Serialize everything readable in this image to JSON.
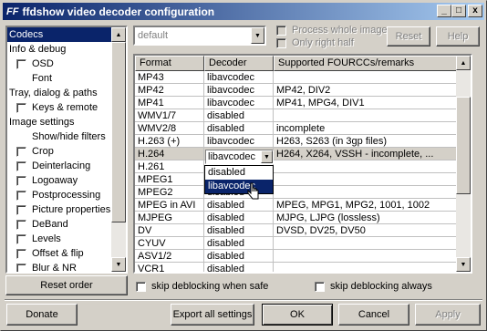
{
  "window": {
    "logo": "FF",
    "title": "ffdshow video decoder configuration",
    "min_label": "_",
    "max_label": "□",
    "close_label": "x"
  },
  "top": {
    "preset_value": "default",
    "process_whole_image": "Process whole image",
    "only_right_half": "Only right half",
    "reset_label": "Reset",
    "help_label": "Help"
  },
  "sidebar": {
    "items": [
      {
        "label": "Codecs",
        "check": false,
        "indent": 0,
        "selected": true
      },
      {
        "label": "Info & debug",
        "check": false,
        "indent": 0,
        "selected": false
      },
      {
        "label": "OSD",
        "check": true,
        "indent": 1,
        "selected": false
      },
      {
        "label": "Font",
        "check": false,
        "indent": 2,
        "selected": false
      },
      {
        "label": "Tray, dialog & paths",
        "check": false,
        "indent": 0,
        "selected": false
      },
      {
        "label": "Keys & remote",
        "check": true,
        "indent": 1,
        "selected": false
      },
      {
        "label": "Image settings",
        "check": false,
        "indent": 0,
        "selected": false
      },
      {
        "label": "Show/hide filters",
        "check": false,
        "indent": 2,
        "selected": false
      },
      {
        "label": "Crop",
        "check": true,
        "indent": 1,
        "selected": false
      },
      {
        "label": "Deinterlacing",
        "check": true,
        "indent": 1,
        "selected": false
      },
      {
        "label": "Logoaway",
        "check": true,
        "indent": 1,
        "selected": false
      },
      {
        "label": "Postprocessing",
        "check": true,
        "indent": 1,
        "selected": false
      },
      {
        "label": "Picture properties",
        "check": true,
        "indent": 1,
        "selected": false
      },
      {
        "label": "DeBand",
        "check": true,
        "indent": 1,
        "selected": false
      },
      {
        "label": "Levels",
        "check": true,
        "indent": 1,
        "selected": false
      },
      {
        "label": "Offset & flip",
        "check": true,
        "indent": 1,
        "selected": false
      },
      {
        "label": "Blur & NR",
        "check": true,
        "indent": 1,
        "selected": false
      }
    ],
    "reset_order_label": "Reset order"
  },
  "table": {
    "headers": [
      "Format",
      "Decoder",
      "Supported FOURCCs/remarks"
    ],
    "rows": [
      [
        "MP43",
        "libavcodec",
        ""
      ],
      [
        "MP42",
        "libavcodec",
        "MP42, DIV2"
      ],
      [
        "MP41",
        "libavcodec",
        "MP41, MPG4, DIV1"
      ],
      [
        "WMV1/7",
        "disabled",
        ""
      ],
      [
        "WMV2/8",
        "disabled",
        "incomplete"
      ],
      [
        "H.263 (+)",
        "libavcodec",
        "H263, S263 (in 3gp files)"
      ],
      [
        "H.264",
        "libavcodec",
        "H264, X264, VSSH - incomplete, ..."
      ],
      [
        "H.261",
        "",
        ""
      ],
      [
        "MPEG1",
        "",
        ""
      ],
      [
        "MPEG2",
        "disabled",
        ""
      ],
      [
        "MPEG in AVI",
        "disabled",
        "MPEG, MPG1, MPG2, 1001, 1002"
      ],
      [
        "MJPEG",
        "disabled",
        "MJPG, LJPG (lossless)"
      ],
      [
        "DV",
        "disabled",
        "DVSD, DV25, DV50"
      ],
      [
        "CYUV",
        "disabled",
        ""
      ],
      [
        "ASV1/2",
        "disabled",
        ""
      ],
      [
        "VCR1",
        "disabled",
        ""
      ]
    ],
    "dropdown_options": [
      "disabled",
      "libavcodec"
    ]
  },
  "bottom": {
    "skip_when_safe": "skip deblocking when safe",
    "skip_always": "skip deblocking always",
    "donate_label": "Donate",
    "export_label": "Export all settings",
    "ok_label": "OK",
    "cancel_label": "Cancel",
    "apply_label": "Apply"
  }
}
